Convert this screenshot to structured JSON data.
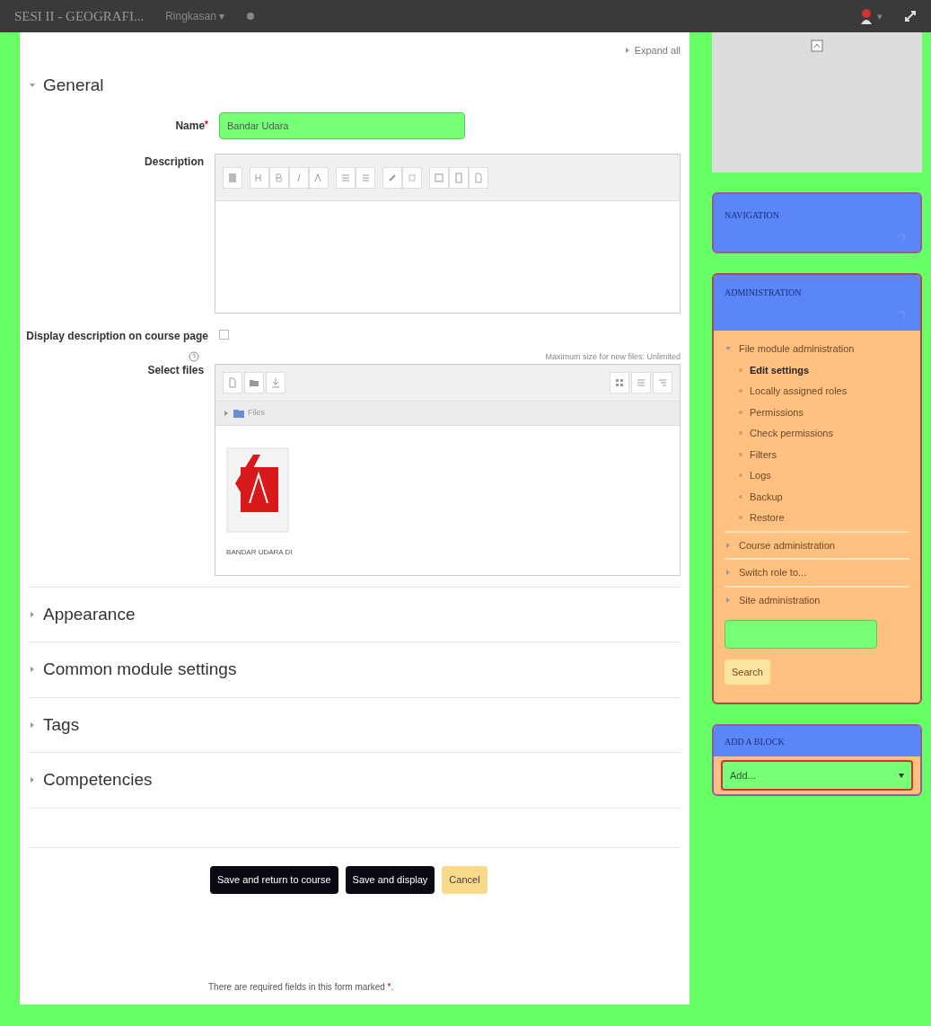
{
  "top_bar": {
    "course_title": "SESI II - GEOGRAFI...",
    "menu": "Ringkasan ▾",
    "user_menu": "▾"
  },
  "expand_all": "Expand all",
  "sections": [
    {
      "title": "General",
      "expanded": true
    },
    {
      "title": "Appearance",
      "expanded": false
    },
    {
      "title": "Common module settings",
      "expanded": false
    },
    {
      "title": "Tags",
      "expanded": false
    },
    {
      "title": "Competencies",
      "expanded": false
    }
  ],
  "form": {
    "name": {
      "label": "Name",
      "required_mark": "*",
      "value": "Bandar Udara"
    },
    "description": {
      "label": "Description"
    },
    "display_description": {
      "label": "Display description on course page",
      "checked": false
    },
    "select_files": {
      "label": "Select files",
      "max_size": "Maximum size for new files: Unlimited",
      "breadcrumb": "Files",
      "file_name": "BANDAR UDARA DI"
    }
  },
  "buttons": [
    {
      "label": "Save and return to course",
      "kind": "primary"
    },
    {
      "label": "Save and display",
      "kind": "primary"
    },
    {
      "label": "Cancel",
      "kind": "secondary"
    }
  ],
  "required_note": {
    "text": "There are required fields in this form marked",
    "mark": "*",
    "end": "."
  },
  "blocks": {
    "navigation": {
      "title": "NAVIGATION"
    },
    "administration": {
      "title": "ADMINISTRATION",
      "items": [
        {
          "label": "File module administration",
          "expanded": true,
          "children": [
            {
              "label": "Edit settings",
              "selected": true
            },
            {
              "label": "Locally assigned roles",
              "selected": false
            },
            {
              "label": "Permissions",
              "selected": false
            },
            {
              "label": "Check permissions",
              "selected": false
            },
            {
              "label": "Filters",
              "selected": false
            },
            {
              "label": "Logs",
              "selected": false
            },
            {
              "label": "Backup",
              "selected": false
            },
            {
              "label": "Restore",
              "selected": false
            }
          ]
        },
        {
          "label": "Course administration",
          "expanded": false
        },
        {
          "label": "Switch role to...",
          "expanded": false
        },
        {
          "label": "Site administration",
          "expanded": false
        }
      ],
      "search_button": "Search"
    },
    "add_block": {
      "title": "ADD A BLOCK",
      "select": "Add..."
    }
  }
}
